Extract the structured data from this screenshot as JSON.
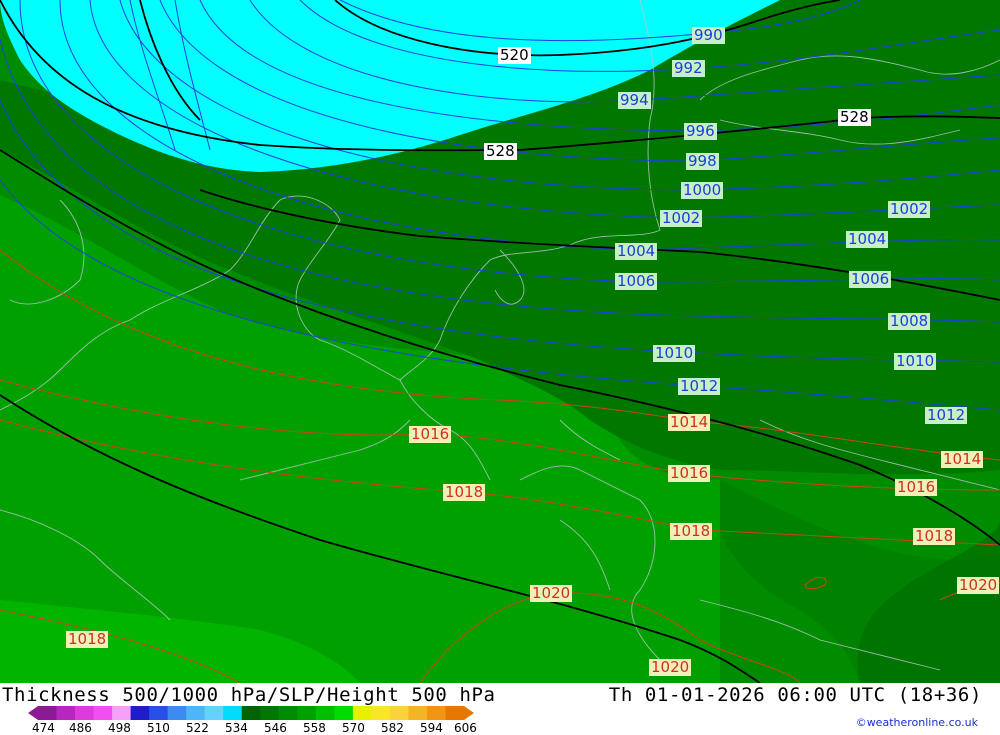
{
  "title": "Thickness 500/1000 hPa/SLP/Height 500 hPa",
  "datetime": "Th 01-01-2026 06:00 UTC (18+36)",
  "credit": "©weatheronline.co.uk",
  "colorbar": {
    "tick_labels": [
      "474",
      "486",
      "498",
      "510",
      "522",
      "534",
      "546",
      "558",
      "570",
      "582",
      "594",
      "606"
    ],
    "colors": [
      "#8c1a96",
      "#b428be",
      "#dc3cdc",
      "#f050f0",
      "#f8a0f8",
      "#1e1ec8",
      "#2850e6",
      "#3c8cf0",
      "#50b4f8",
      "#64d2fc",
      "#00dcfa",
      "#006400",
      "#007800",
      "#008c00",
      "#00a000",
      "#00be00",
      "#00dc00",
      "#e6f000",
      "#fae628",
      "#fad23c",
      "#f5b428",
      "#f09614",
      "#e67800"
    ]
  },
  "thickness_fill_colors": {
    "cyan": "#00ffff",
    "dark_green": "#007800",
    "green": "#008c00",
    "mid_green": "#00a000",
    "light_green": "#00b400"
  },
  "slp_labels_blue": [
    {
      "text": "990"
    },
    {
      "text": "992"
    },
    {
      "text": "994"
    },
    {
      "text": "996"
    },
    {
      "text": "998"
    },
    {
      "text": "1000"
    },
    {
      "text": "1002"
    },
    {
      "text": "1002"
    },
    {
      "text": "1004"
    },
    {
      "text": "1004"
    },
    {
      "text": "1006"
    },
    {
      "text": "1006"
    },
    {
      "text": "1008"
    },
    {
      "text": "1010"
    },
    {
      "text": "1010"
    },
    {
      "text": "1012"
    },
    {
      "text": "1012"
    }
  ],
  "slp_labels_red": [
    {
      "text": "1014"
    },
    {
      "text": "1014"
    },
    {
      "text": "1016"
    },
    {
      "text": "1016"
    },
    {
      "text": "1016"
    },
    {
      "text": "1018"
    },
    {
      "text": "1018"
    },
    {
      "text": "1018"
    },
    {
      "text": "1018"
    },
    {
      "text": "1020"
    },
    {
      "text": "1020"
    },
    {
      "text": "1020"
    }
  ],
  "height_labels": [
    {
      "text": "520"
    },
    {
      "text": "528"
    },
    {
      "text": "528"
    }
  ]
}
